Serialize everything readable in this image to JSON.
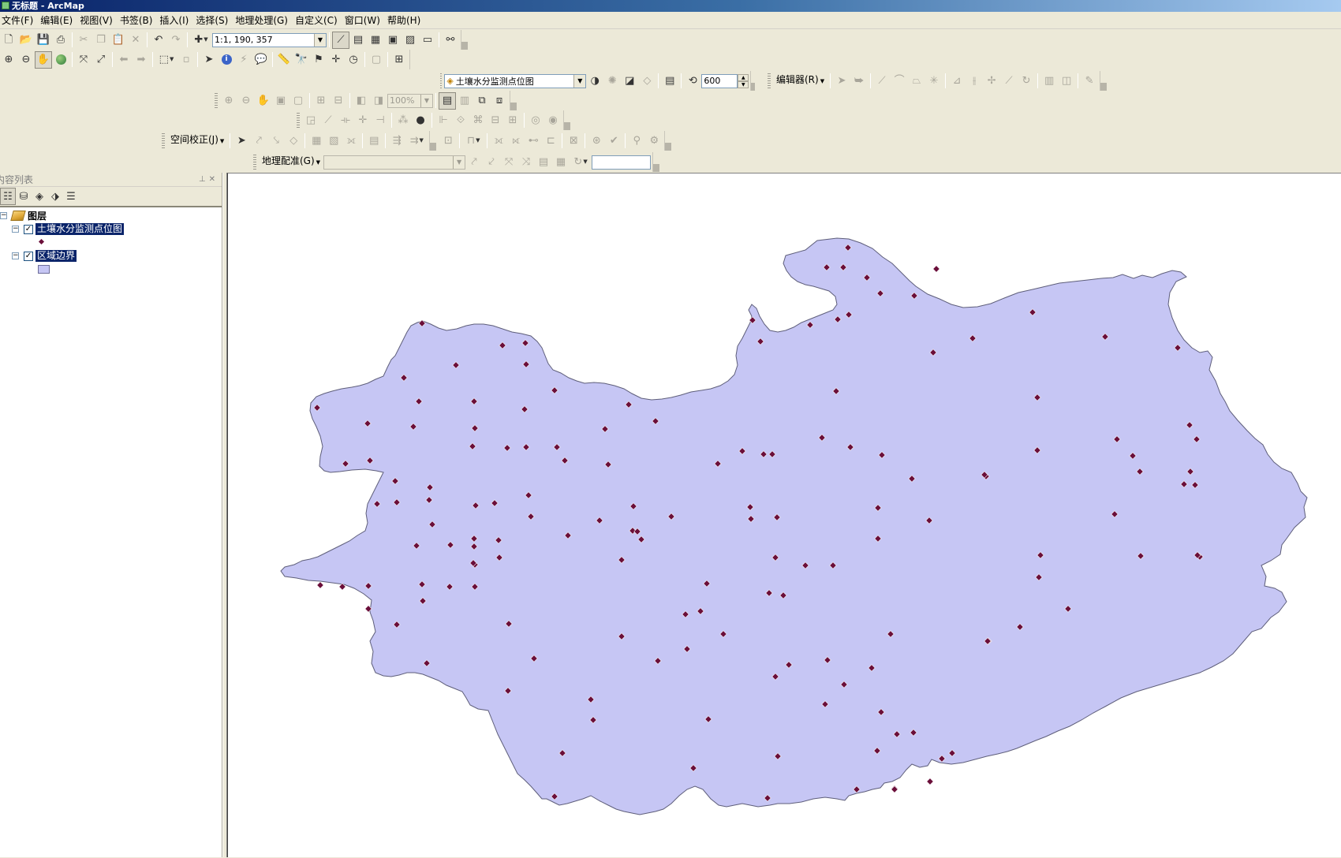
{
  "window": {
    "title": "无标题 - ArcMap"
  },
  "menu": [
    "文件(F)",
    "编辑(E)",
    "视图(V)",
    "书签(B)",
    "插入(I)",
    "选择(S)",
    "地理处理(G)",
    "自定义(C)",
    "窗口(W)",
    "帮助(H)"
  ],
  "toolbar": {
    "scale": "1:1, 190, 357",
    "layer_select": "土壤水分监测点位图",
    "tolerance": "600",
    "editor_label": "编辑器(R)",
    "zoom_percent": "100%",
    "spatial_adjust_label": "空间校正(J)",
    "georef_label": "地理配准(G)",
    "georef_layer": "",
    "georef_text": ""
  },
  "toc": {
    "title": "内容列表",
    "root": "图层",
    "layers": [
      {
        "name": "土壤水分监测点位图",
        "visible": true,
        "symbol": "point",
        "symbol_color": "#6b0f3a"
      },
      {
        "name": "区域边界",
        "visible": true,
        "symbol": "polygon",
        "symbol_color": "#c6c6f4"
      }
    ]
  },
  "map": {
    "region_fill": "#c6c6f4",
    "region_stroke": "#5e5e7a",
    "point_color": "#6b0f3a"
  }
}
